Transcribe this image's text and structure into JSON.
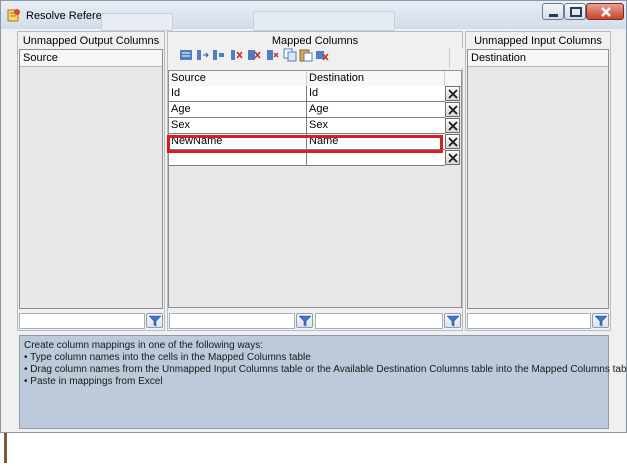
{
  "window": {
    "title": "Resolve References"
  },
  "panels": {
    "unmapped_output": {
      "heading": "Unmapped Output Columns",
      "column": "Source"
    },
    "mapped": {
      "heading": "Mapped Columns",
      "source_header": "Source",
      "destination_header": "Destination"
    },
    "unmapped_input": {
      "heading": "Unmapped Input Columns",
      "column": "Destination"
    }
  },
  "mappings": [
    {
      "source": "Id",
      "destination": "Id"
    },
    {
      "source": "Age",
      "destination": "Age"
    },
    {
      "source": "Sex",
      "destination": "Sex"
    },
    {
      "source": "NewName",
      "destination": "Name"
    },
    {
      "source": "",
      "destination": ""
    }
  ],
  "info": {
    "lines": [
      "Create column mappings in one of the following ways:",
      "• Type column names into the cells in the Mapped Columns table",
      "• Drag column names from the Unmapped Input Columns table or the Available Destination Columns table into the Mapped Columns table",
      "• Paste in mappings from Excel"
    ]
  },
  "colors": {
    "highlight": "#d81e1e",
    "info_bg": "#bccad9"
  }
}
